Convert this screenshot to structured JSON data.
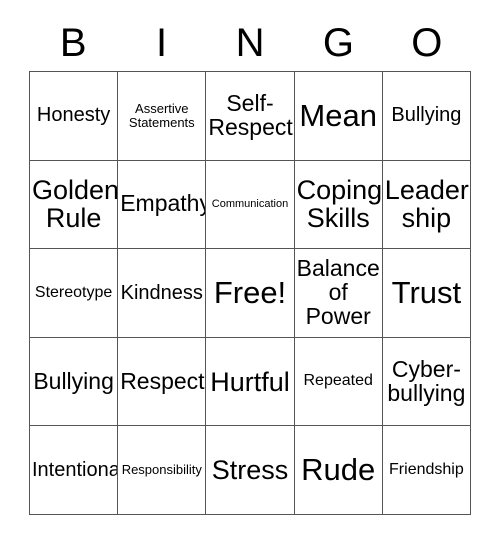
{
  "card": {
    "header_letters": [
      "B",
      "I",
      "N",
      "G",
      "O"
    ],
    "background_color": "#ffffff",
    "border_color": "#555555",
    "text_color": "#000000",
    "rows": [
      [
        {
          "label": "Honesty",
          "size": "md"
        },
        {
          "label": "Assertive\nStatements",
          "size": "xs"
        },
        {
          "label": "Self-\nRespect",
          "size": "lg"
        },
        {
          "label": "Mean",
          "size": "xxl"
        },
        {
          "label": "Bullying",
          "size": "md"
        }
      ],
      [
        {
          "label": "Golden\nRule",
          "size": "xl"
        },
        {
          "label": "Empathy",
          "size": "lg"
        },
        {
          "label": "Communication",
          "size": "xxs"
        },
        {
          "label": "Coping\nSkills",
          "size": "xl"
        },
        {
          "label": "Leader-\nship",
          "size": "xl"
        }
      ],
      [
        {
          "label": "Stereotype",
          "size": "sm"
        },
        {
          "label": "Kindness",
          "size": "md"
        },
        {
          "label": "Free!",
          "size": "xxl"
        },
        {
          "label": "Balance\nof\nPower",
          "size": "lg"
        },
        {
          "label": "Trust",
          "size": "xxl"
        }
      ],
      [
        {
          "label": "Bullying",
          "size": "lg"
        },
        {
          "label": "Respect",
          "size": "lg"
        },
        {
          "label": "Hurtful",
          "size": "xl"
        },
        {
          "label": "Repeated",
          "size": "sm"
        },
        {
          "label": "Cyber-\nbullying",
          "size": "lg"
        }
      ],
      [
        {
          "label": "Intentional",
          "size": "md"
        },
        {
          "label": "Responsibility",
          "size": "xs"
        },
        {
          "label": "Stress",
          "size": "xl"
        },
        {
          "label": "Rude",
          "size": "xxl"
        },
        {
          "label": "Friendship",
          "size": "sm"
        }
      ]
    ]
  }
}
